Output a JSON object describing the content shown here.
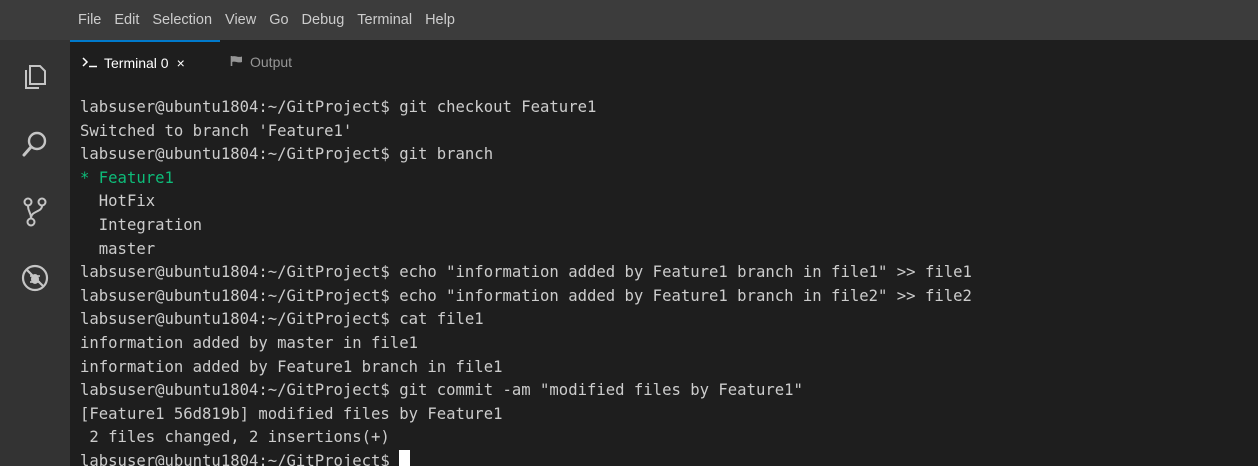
{
  "menu": [
    "File",
    "Edit",
    "Selection",
    "View",
    "Go",
    "Debug",
    "Terminal",
    "Help"
  ],
  "tabs": {
    "terminal": {
      "label": "Terminal 0",
      "close": "×"
    },
    "output": {
      "label": "Output"
    }
  },
  "activity_icons": [
    "files-icon",
    "search-icon",
    "source-control-icon",
    "debug-icon"
  ],
  "colors": {
    "accent": "#007acc",
    "branch_current": "#0dbc79",
    "text": "#cccccc",
    "background": "#1e1e1e"
  },
  "terminal": {
    "lines": [
      {
        "text": "labsuser@ubuntu1804:~/GitProject$ git checkout Feature1"
      },
      {
        "text": "Switched to branch 'Feature1'"
      },
      {
        "text": "labsuser@ubuntu1804:~/GitProject$ git branch"
      },
      {
        "text": "* Feature1",
        "color": "green"
      },
      {
        "text": "  HotFix"
      },
      {
        "text": "  Integration"
      },
      {
        "text": "  master"
      },
      {
        "text": "labsuser@ubuntu1804:~/GitProject$ echo \"information added by Feature1 branch in file1\" >> file1"
      },
      {
        "text": "labsuser@ubuntu1804:~/GitProject$ echo \"information added by Feature1 branch in file2\" >> file2"
      },
      {
        "text": "labsuser@ubuntu1804:~/GitProject$ cat file1"
      },
      {
        "text": "information added by master in file1"
      },
      {
        "text": "information added by Feature1 branch in file1"
      },
      {
        "text": "labsuser@ubuntu1804:~/GitProject$ git commit -am \"modified files by Feature1\""
      },
      {
        "text": "[Feature1 56d819b] modified files by Feature1"
      },
      {
        "text": " 2 files changed, 2 insertions(+)"
      }
    ],
    "prompt": "labsuser@ubuntu1804:~/GitProject$ "
  }
}
